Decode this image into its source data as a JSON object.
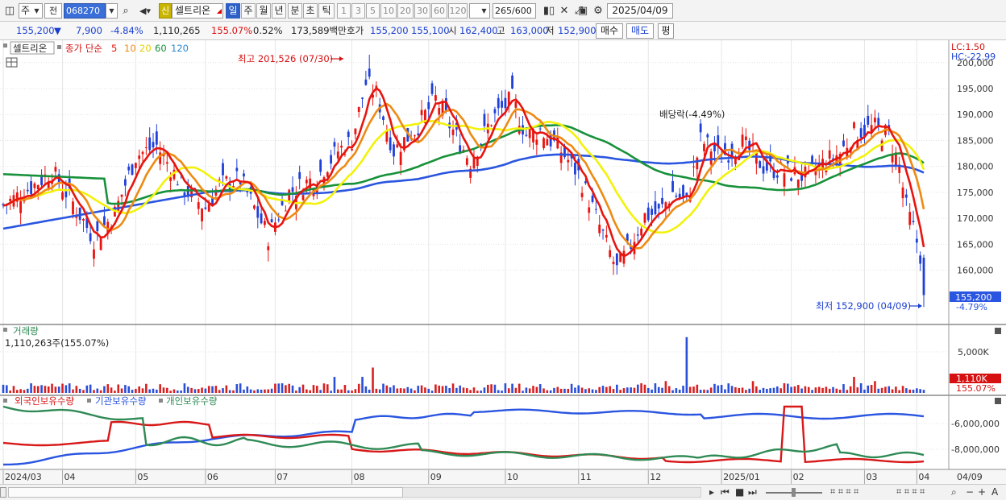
{
  "toolbar": {
    "period_type": "주",
    "prev_label": "전",
    "stock_code": "068270",
    "new_badge": "신",
    "stock_name": "셀트리온",
    "periods": [
      "일",
      "주",
      "월",
      "년",
      "분",
      "초",
      "틱"
    ],
    "active_period": "일",
    "intervals": [
      "1",
      "3",
      "5",
      "10",
      "20",
      "30",
      "60",
      "120"
    ],
    "count": "265",
    "count_total": "/600",
    "date": "2025/04/09"
  },
  "quote": {
    "price": "155,200",
    "change_arrow": "▼",
    "change": "7,900",
    "change_pct": "-4.84%",
    "volume": "1,110,265",
    "volume_ratio": "155.07%",
    "turnover": "0.52%",
    "amount": "173,589백만",
    "hoga_label": "호가",
    "ask": "155,200",
    "bid": "155,100",
    "open_label": "시",
    "open": "162,400",
    "high_label": "고",
    "high": "163,000",
    "low_label": "저",
    "low": "152,900",
    "buy_label": "매수",
    "sell_label": "매도",
    "avg_label": "평"
  },
  "price_panel": {
    "name_tag": "셀트리온",
    "ma_label": "종가 단순",
    "ma_periods": [
      "5",
      "10",
      "20",
      "60",
      "120"
    ],
    "ma_colors": [
      "#e8140f",
      "#ee8a12",
      "#f2f20a",
      "#17913a",
      "#2a55e0"
    ],
    "lc": "LC:1.50",
    "hc": "HC:-22.99",
    "high_annotation": "최고 201,526 (07/30)",
    "low_annotation": "최저 152,900 (04/09)",
    "dividend_annotation": "배당락(-4.49%)",
    "current_price_tag": "155,200",
    "current_change_tag": "-4.79%",
    "y_ticks": [
      "200,000",
      "195,000",
      "190,000",
      "185,000",
      "180,000",
      "175,000",
      "170,000",
      "165,000",
      "160,000"
    ]
  },
  "volume_panel": {
    "title": "거래량",
    "value_text": "1,110,263주(155.07%)",
    "y_tick": "5,000K",
    "current_tag": "1,110K",
    "current_pct": "155.07%"
  },
  "holdings_panel": {
    "series": [
      {
        "name": "외국인보유수량",
        "color": "#d81818"
      },
      {
        "name": "기관보유수량",
        "color": "#2a55e0"
      },
      {
        "name": "개인보유수량",
        "color": "#2f8a55"
      }
    ],
    "y_ticks": [
      "-6,000,000",
      "-8,000,000"
    ]
  },
  "x_axis": {
    "labels": [
      "2024/03",
      "04",
      "05",
      "06",
      "07",
      "08",
      "09",
      "10",
      "11",
      "12",
      "2025/01",
      "02",
      "03",
      "04"
    ],
    "end_label": "04/09"
  },
  "chart_data": [
    {
      "type": "line",
      "title": "",
      "series": [
        {
          "name": "5",
          "color": "#e8140f"
        },
        {
          "name": "10",
          "color": "#ee8a12"
        },
        {
          "name": "20",
          "color": "#f2f20a"
        },
        {
          "name": "60",
          "color": "#17913a"
        },
        {
          "name": "120",
          "color": "#2a55e0"
        }
      ],
      "ylim": [
        150000,
        204000
      ],
      "keypoints": [
        {
          "date": "2024/07/30",
          "high": 201526
        },
        {
          "date": "2025/04/09",
          "close": 155200,
          "low": 152900
        }
      ]
    }
  ]
}
